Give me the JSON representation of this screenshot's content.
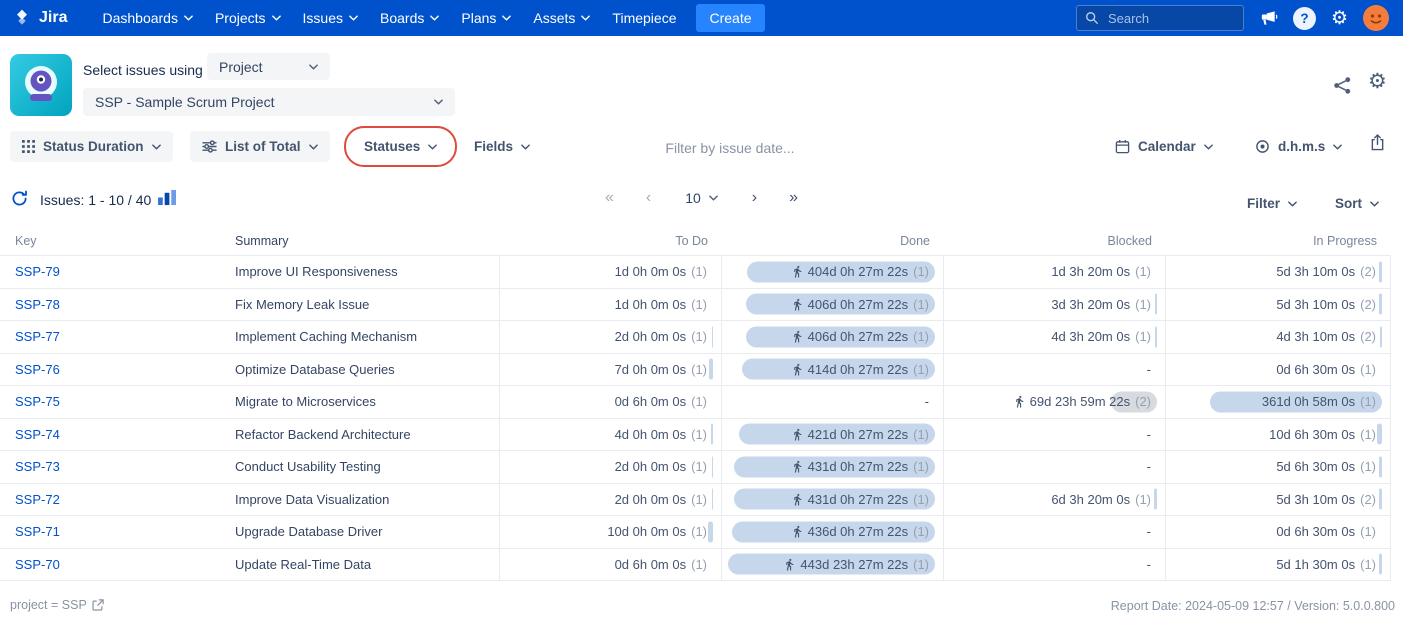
{
  "topnav": {
    "logo": "Jira",
    "items": [
      {
        "label": "Dashboards",
        "menu": true
      },
      {
        "label": "Projects",
        "menu": true
      },
      {
        "label": "Issues",
        "menu": true
      },
      {
        "label": "Boards",
        "menu": true
      },
      {
        "label": "Plans",
        "menu": true
      },
      {
        "label": "Assets",
        "menu": true
      },
      {
        "label": "Timepiece",
        "menu": false
      }
    ],
    "create": "Create",
    "search_placeholder": "Search",
    "help_label": "?"
  },
  "selector": {
    "label": "Select issues using",
    "mode": "Project",
    "project": "SSP - Sample Scrum Project"
  },
  "toolbar": {
    "status_duration": "Status Duration",
    "list_of_total": "List of Total",
    "statuses": "Statuses",
    "fields": "Fields",
    "date_filter_placeholder": "Filter by issue date...",
    "calendar": "Calendar",
    "time_format": "d.h.m.s"
  },
  "pagination": {
    "issues_label": "Issues: 1 - 10 / 40",
    "first": "«",
    "prev": "‹",
    "page_size": "10",
    "next": "›",
    "last": "»",
    "filter": "Filter",
    "sort": "Sort"
  },
  "table": {
    "columns": [
      "Key",
      "Summary",
      "To Do",
      "Done",
      "Blocked",
      "In Progress"
    ],
    "rows": [
      {
        "key": "SSP-79",
        "summary": "Improve UI Responsiveness",
        "todo": {
          "v": "1d 0h 0m 0s",
          "c": "(1)",
          "bar": 0
        },
        "done": {
          "v": "404d 0h 27m 22s",
          "c": "(1)",
          "bar": 188,
          "run": true
        },
        "blocked": {
          "v": "1d 3h 20m 0s",
          "c": "(1)",
          "bar": 0
        },
        "inprog": {
          "v": "5d 3h 10m 0s",
          "c": "(2)",
          "bar": 3
        }
      },
      {
        "key": "SSP-78",
        "summary": "Fix Memory Leak Issue",
        "todo": {
          "v": "1d 0h 0m 0s",
          "c": "(1)",
          "bar": 0
        },
        "done": {
          "v": "406d 0h 27m 22s",
          "c": "(1)",
          "bar": 189,
          "run": true
        },
        "blocked": {
          "v": "3d 3h 20m 0s",
          "c": "(1)",
          "bar": 2
        },
        "inprog": {
          "v": "5d 3h 10m 0s",
          "c": "(2)",
          "bar": 3
        }
      },
      {
        "key": "SSP-77",
        "summary": "Implement Caching Mechanism",
        "todo": {
          "v": "2d 0h 0m 0s",
          "c": "(1)",
          "bar": 1
        },
        "done": {
          "v": "406d 0h 27m 22s",
          "c": "(1)",
          "bar": 189,
          "run": true
        },
        "blocked": {
          "v": "4d 3h 20m 0s",
          "c": "(1)",
          "bar": 2
        },
        "inprog": {
          "v": "4d 3h 10m 0s",
          "c": "(2)",
          "bar": 2
        }
      },
      {
        "key": "SSP-76",
        "summary": "Optimize Database Queries",
        "todo": {
          "v": "7d 0h 0m 0s",
          "c": "(1)",
          "bar": 4
        },
        "done": {
          "v": "414d 0h 27m 22s",
          "c": "(1)",
          "bar": 193,
          "run": true
        },
        "blocked": {
          "v": "-",
          "c": "",
          "bar": 0
        },
        "inprog": {
          "v": "0d 6h 30m 0s",
          "c": "(1)",
          "bar": 0
        }
      },
      {
        "key": "SSP-75",
        "summary": "Migrate to Microservices",
        "todo": {
          "v": "0d 6h 0m 0s",
          "c": "(1)",
          "bar": 0
        },
        "done": {
          "v": "-",
          "c": "",
          "bar": 0
        },
        "blocked": {
          "v": "69d 23h 59m 22s",
          "c": "(2)",
          "bar": 46,
          "run": true,
          "gray": true
        },
        "inprog": {
          "v": "361d 0h 58m 0s",
          "c": "(1)",
          "bar": 172
        }
      },
      {
        "key": "SSP-74",
        "summary": "Refactor Backend Architecture",
        "todo": {
          "v": "4d 0h 0m 0s",
          "c": "(1)",
          "bar": 2
        },
        "done": {
          "v": "421d 0h 27m 22s",
          "c": "(1)",
          "bar": 196,
          "run": true
        },
        "blocked": {
          "v": "-",
          "c": "",
          "bar": 0
        },
        "inprog": {
          "v": "10d 6h 30m 0s",
          "c": "(1)",
          "bar": 5
        }
      },
      {
        "key": "SSP-73",
        "summary": "Conduct Usability Testing",
        "todo": {
          "v": "2d 0h 0m 0s",
          "c": "(1)",
          "bar": 1
        },
        "done": {
          "v": "431d 0h 27m 22s",
          "c": "(1)",
          "bar": 201,
          "run": true
        },
        "blocked": {
          "v": "-",
          "c": "",
          "bar": 0
        },
        "inprog": {
          "v": "5d 6h 30m 0s",
          "c": "(1)",
          "bar": 3
        }
      },
      {
        "key": "SSP-72",
        "summary": "Improve Data Visualization",
        "todo": {
          "v": "2d 0h 0m 0s",
          "c": "(1)",
          "bar": 1
        },
        "done": {
          "v": "431d 0h 27m 22s",
          "c": "(1)",
          "bar": 201,
          "run": true
        },
        "blocked": {
          "v": "6d 3h 20m 0s",
          "c": "(1)",
          "bar": 3
        },
        "inprog": {
          "v": "5d 3h 10m 0s",
          "c": "(2)",
          "bar": 3
        }
      },
      {
        "key": "SSP-71",
        "summary": "Upgrade Database Driver",
        "todo": {
          "v": "10d 0h 0m 0s",
          "c": "(1)",
          "bar": 5
        },
        "done": {
          "v": "436d 0h 27m 22s",
          "c": "(1)",
          "bar": 203,
          "run": true
        },
        "blocked": {
          "v": "-",
          "c": "",
          "bar": 0
        },
        "inprog": {
          "v": "0d 6h 30m 0s",
          "c": "(1)",
          "bar": 0
        }
      },
      {
        "key": "SSP-70",
        "summary": "Update Real-Time Data",
        "todo": {
          "v": "0d 6h 0m 0s",
          "c": "(1)",
          "bar": 0
        },
        "done": {
          "v": "443d 23h 27m 22s",
          "c": "(1)",
          "bar": 207,
          "run": true
        },
        "blocked": {
          "v": "-",
          "c": "",
          "bar": 0
        },
        "inprog": {
          "v": "5d 1h 30m 0s",
          "c": "(1)",
          "bar": 3
        }
      }
    ]
  },
  "footer": {
    "left": "project = SSP",
    "right": "Report Date: 2024-05-09 12:57 / Version: 5.0.0.800"
  },
  "colors": {
    "nav_blue": "#0052CC",
    "nav_dark": "#0747A6",
    "create_blue": "#2684FF",
    "link_blue": "#0052CC",
    "duration_bar": "#C6D7EC",
    "duration_bar_gray": "#D7DADE",
    "annotation_red": "#DD4B3B",
    "app_teal": "#00B8D9",
    "app_purple": "#6554C0",
    "avatar_orange": "#F57C3B"
  }
}
